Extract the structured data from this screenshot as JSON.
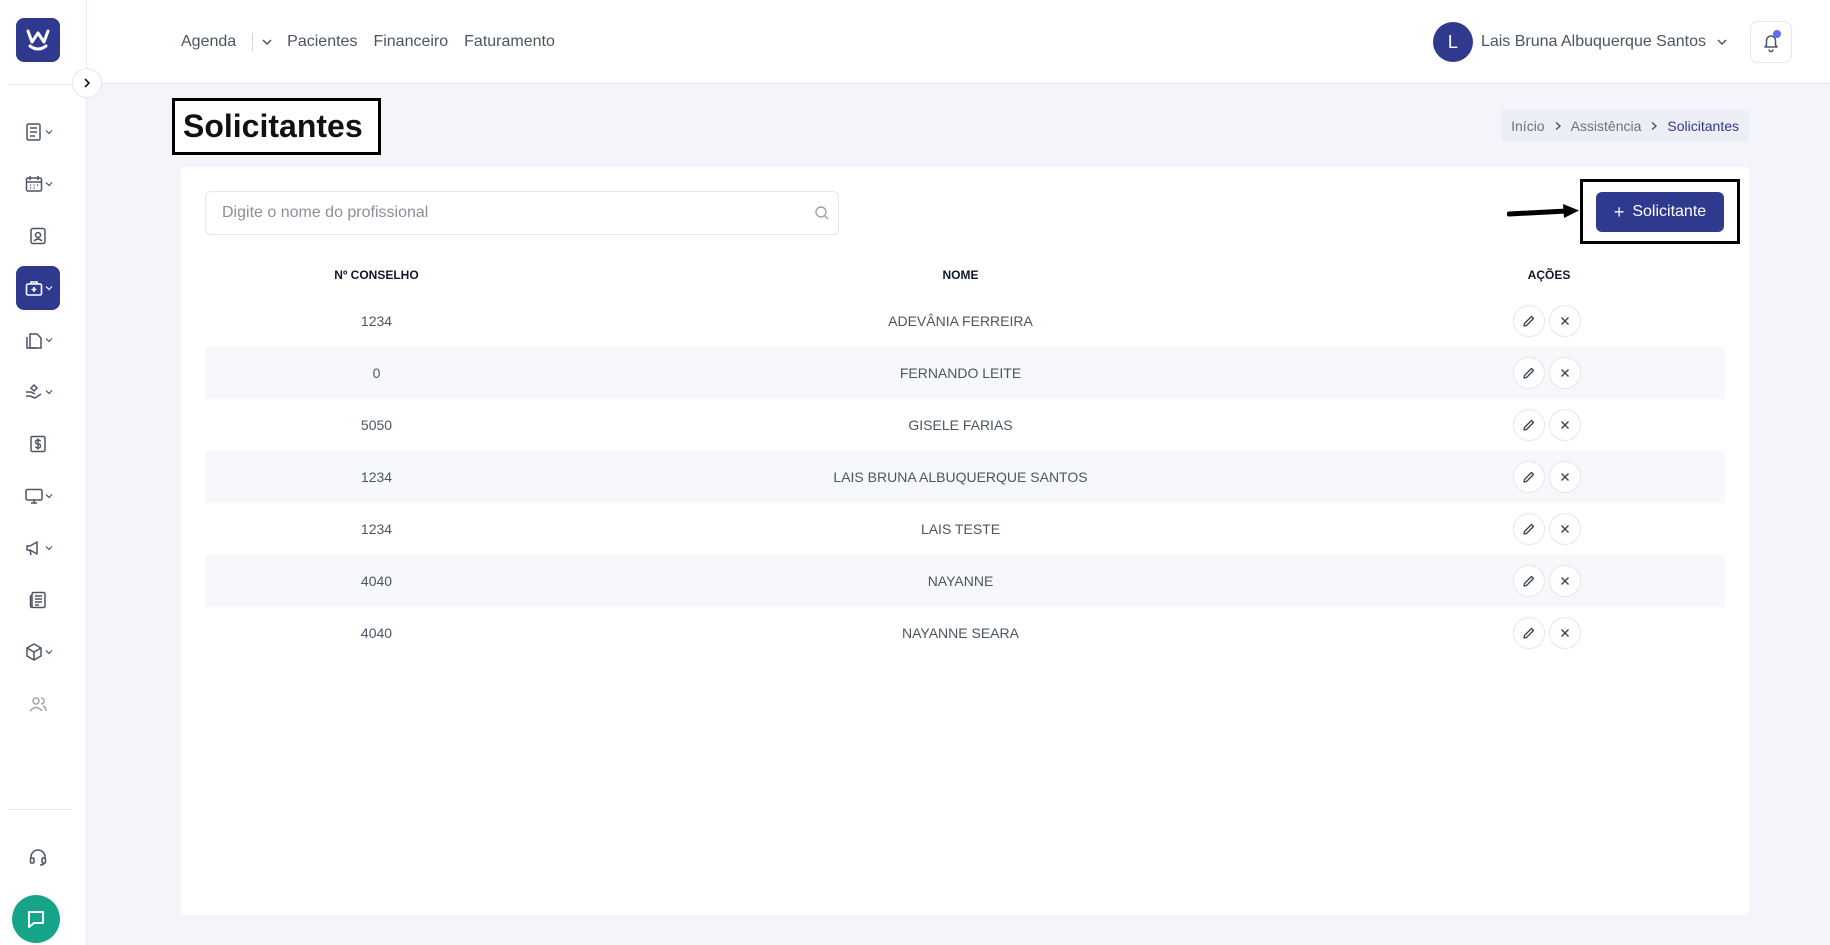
{
  "app": {
    "logo_letter": "W"
  },
  "nav": {
    "items": [
      "Agenda",
      "Pacientes",
      "Financeiro",
      "Faturamento"
    ]
  },
  "user": {
    "initial": "L",
    "name": "Lais Bruna Albuquerque Santos"
  },
  "page": {
    "title": "Solicitantes"
  },
  "breadcrumb": {
    "items": [
      "Início",
      "Assistência",
      "Solicitantes"
    ]
  },
  "search": {
    "placeholder": "Digite o nome do profissional",
    "value": ""
  },
  "add_button": {
    "label": "Solicitante"
  },
  "table": {
    "headers": [
      "Nº CONSELHO",
      "NOME",
      "AÇÕES"
    ],
    "rows": [
      {
        "conselho": "1234",
        "nome": "ADEVÂNIA FERREIRA"
      },
      {
        "conselho": "0",
        "nome": "FERNANDO LEITE"
      },
      {
        "conselho": "5050",
        "nome": "GISELE FARIAS"
      },
      {
        "conselho": "1234",
        "nome": "LAIS BRUNA ALBUQUERQUE SANTOS"
      },
      {
        "conselho": "1234",
        "nome": "LAIS TESTE"
      },
      {
        "conselho": "4040",
        "nome": "NAYANNE"
      },
      {
        "conselho": "4040",
        "nome": "NAYANNE SEARA"
      }
    ]
  },
  "sidebar": {
    "icons": [
      "document-list-icon",
      "calendar-icon",
      "patient-badge-icon",
      "medical-kit-icon",
      "documents-icon",
      "hand-care-icon",
      "dollar-icon",
      "monitor-icon",
      "megaphone-icon",
      "newspaper-icon",
      "package-icon",
      "users-icon",
      "headset-icon"
    ]
  },
  "colors": {
    "primary": "#2f3a8f",
    "background": "#f4f5fb",
    "chat": "#17a589"
  }
}
